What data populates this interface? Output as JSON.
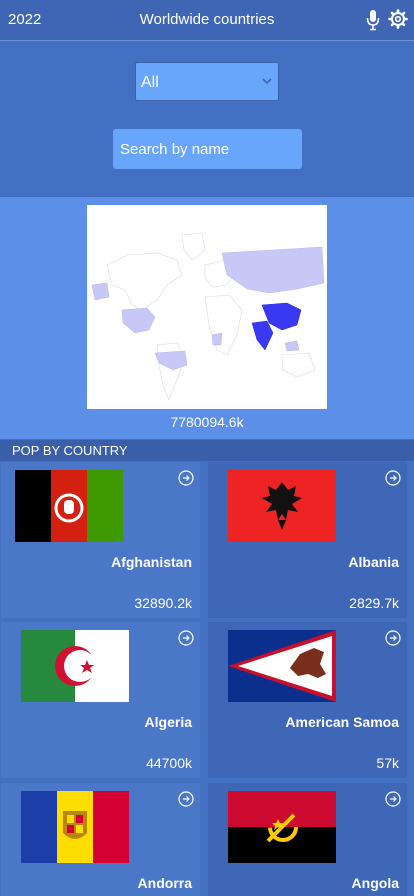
{
  "header": {
    "year": "2022",
    "title": "Worldwide countries",
    "icons": [
      "mic-icon",
      "gear-icon"
    ]
  },
  "filter": {
    "selected": "All"
  },
  "search": {
    "placeholder": "Search by name"
  },
  "map": {
    "total": "7780094.6k",
    "highlight_color": "#3939f3",
    "light_color": "#c8c8f7"
  },
  "pop_section": {
    "title": "POP BY COUNTRY"
  },
  "countries": [
    {
      "name": "Afghanistan",
      "pop": "32890.2k",
      "flag": "afghanistan-flag-icon"
    },
    {
      "name": "Albania",
      "pop": "2829.7k",
      "flag": "albania-flag-icon"
    },
    {
      "name": "Algeria",
      "pop": "44700k",
      "flag": "algeria-flag-icon"
    },
    {
      "name": "American Samoa",
      "pop": "57k",
      "flag": "american-samoa-flag-icon"
    },
    {
      "name": "Andorra",
      "pop": "",
      "flag": "andorra-flag-icon"
    },
    {
      "name": "Angola",
      "pop": "",
      "flag": "angola-flag-icon"
    }
  ]
}
